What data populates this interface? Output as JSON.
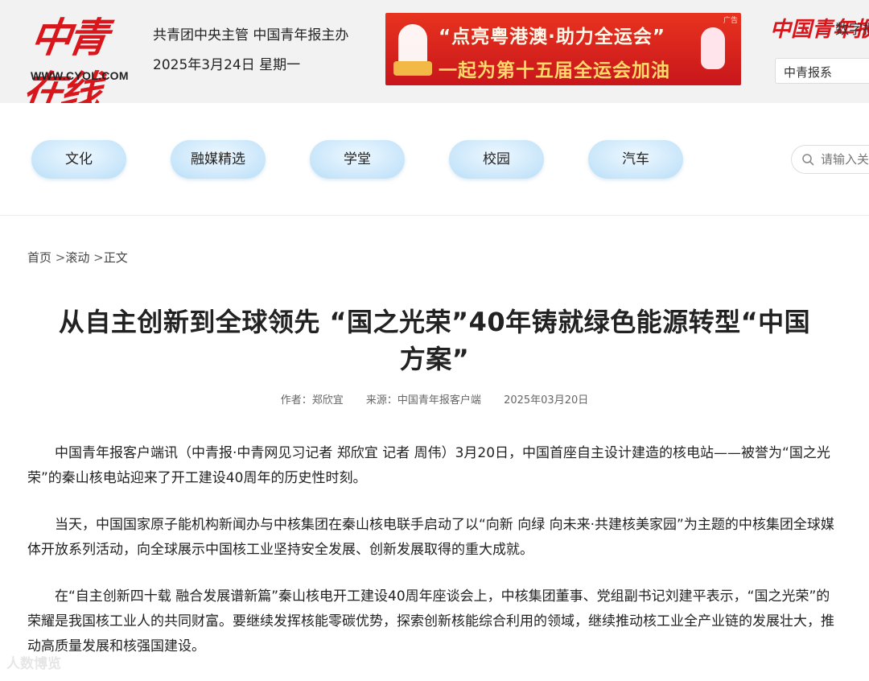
{
  "header": {
    "logo_cn": "中青在线",
    "logo_en": "WWW.CYOL.COM",
    "sponsor": "共青团中央主管 中国青年报主办",
    "date": "2025年3月24日 星期一",
    "banner": {
      "ad_label": "广告",
      "line1": "“点亮粤港澳·助力全运会”",
      "line2": "一起为第十五届全运会加油"
    },
    "right_logo": "中国青年报",
    "right_sub": "数字报",
    "paper_select": "中青报系"
  },
  "nav": {
    "items": [
      "文化",
      "融媒精选",
      "学堂",
      "校园",
      "汽车"
    ]
  },
  "search": {
    "placeholder": "请输入关键词"
  },
  "breadcrumb": {
    "home": "首页",
    "sep1": " >",
    "section": "滚动",
    "sep2": " >",
    "current": "正文"
  },
  "article": {
    "title": "从自主创新到全球领先 “国之光荣”40年铸就绿色能源转型“中国方案”",
    "author": "作者：郑欣宜",
    "source": "来源：中国青年报客户端",
    "date": "2025年03月20日",
    "paragraphs": [
      "中国青年报客户端讯（中青报·中青网见习记者 郑欣宜 记者 周伟）3月20日，中国首座自主设计建造的核电站——被誉为“国之光荣”的秦山核电站迎来了开工建设40周年的历史性时刻。",
      "当天，中国国家原子能机构新闻办与中核集团在秦山核电联手启动了以“向新 向绿 向未来·共建核美家园”为主题的中核集团全球媒体开放系列活动，向全球展示中国核工业坚持安全发展、创新发展取得的重大成就。",
      "在“自主创新四十载 融合发展谱新篇”秦山核电开工建设40周年座谈会上，中核集团董事、党组副书记刘建平表示，“国之光荣”的荣耀是我国核工业人的共同财富。要继续发挥核能零碳优势，探索创新核能综合利用的领域，继续推动核工业全产业链的发展壮大，推动高质量发展和核强国建设。"
    ]
  },
  "watermark": "人数博览",
  "colors": {
    "brand_red": "#d9161c",
    "nav_pill": "#cfe9fb"
  }
}
